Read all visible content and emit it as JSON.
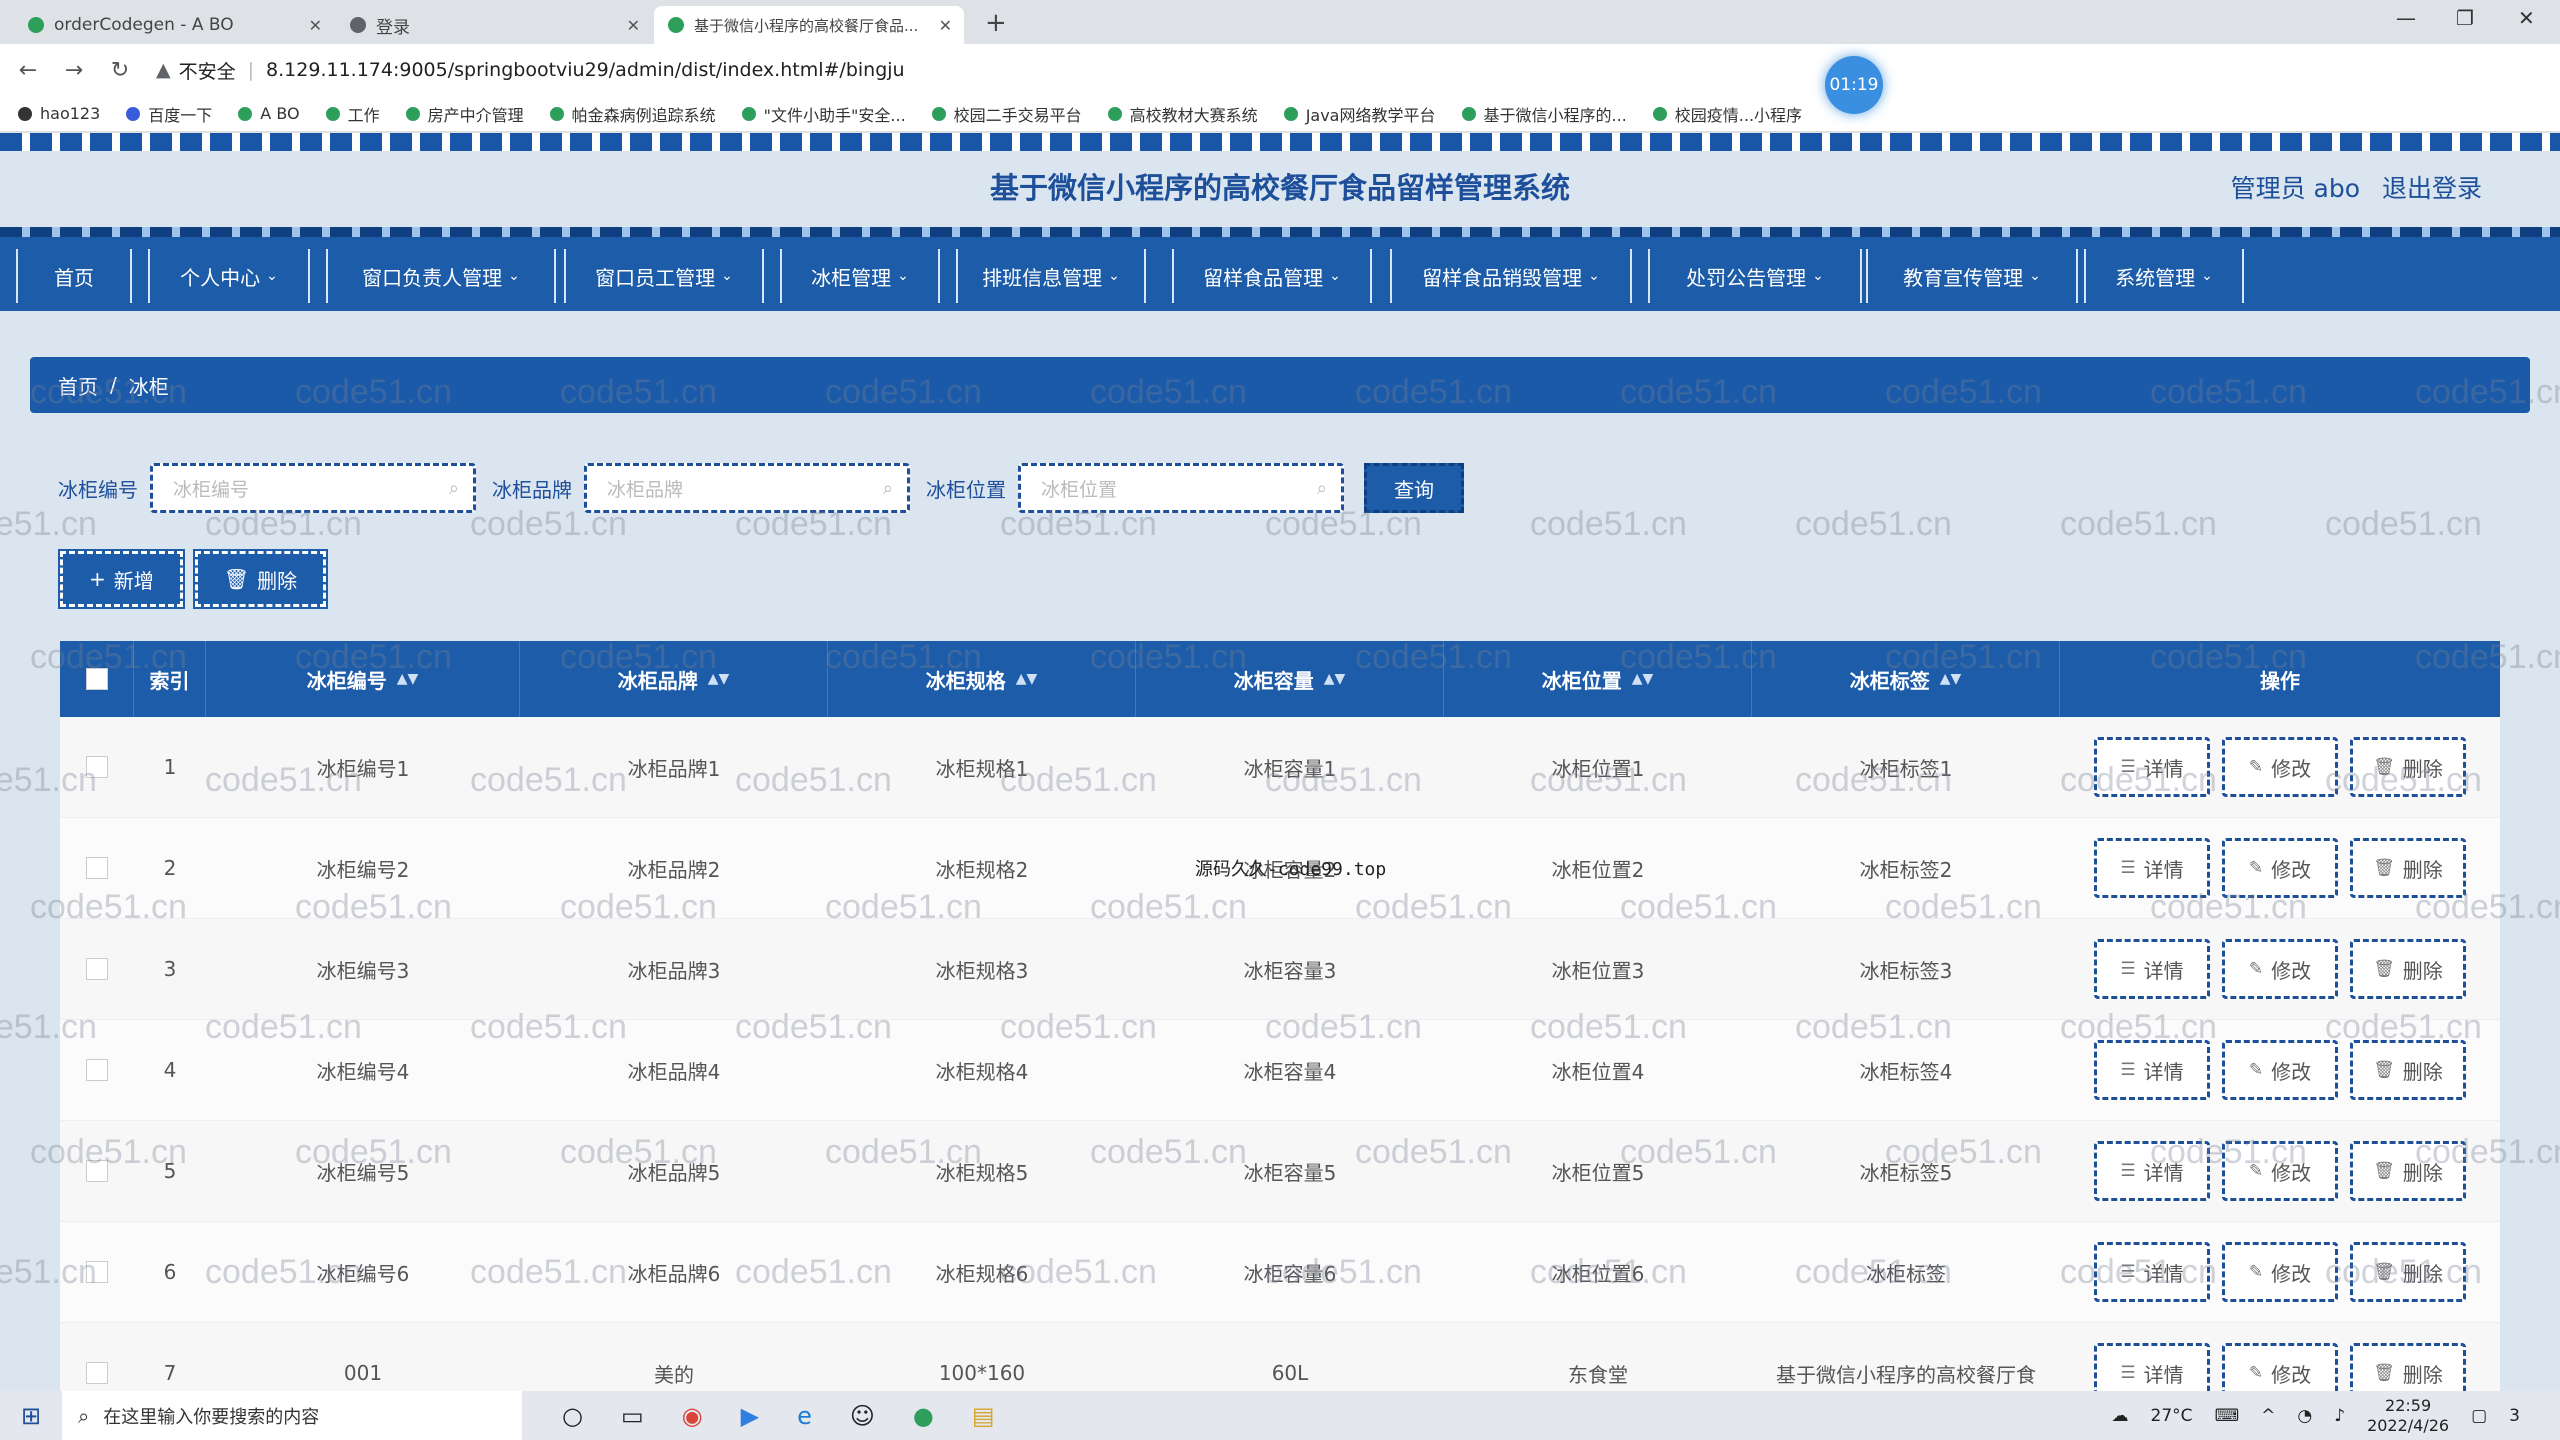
{
  "browser": {
    "tabs": [
      {
        "title": "orderCodegen - A BO",
        "active": false
      },
      {
        "title": "登录",
        "active": false
      },
      {
        "title": "基于微信小程序的高校餐厅食品...",
        "active": true
      }
    ],
    "new_tab": "+",
    "security": "不安全",
    "url": "8.129.11.174:9005/springbootviu29/admin/dist/index.html#/bingju",
    "timer": "01:19",
    "bookmarks": [
      "hao123",
      "百度一下",
      "A BO",
      "工作",
      "房产中介管理",
      "帕金森病例追踪系统",
      "\"文件小助手\"安全...",
      "校园二手交易平台",
      "高校教材大赛系统",
      "Java网络教学平台",
      "基于微信小程序的...",
      "校园疫情...小程序"
    ]
  },
  "header": {
    "title": "基于微信小程序的高校餐厅食品留样管理系统",
    "user": "管理员 abo",
    "logout": "退出登录"
  },
  "menu": [
    {
      "label": "首页",
      "caret": false
    },
    {
      "label": "个人中心",
      "caret": true
    },
    {
      "label": "窗口负责人管理",
      "caret": true
    },
    {
      "label": "窗口员工管理",
      "caret": true
    },
    {
      "label": "冰柜管理",
      "caret": true
    },
    {
      "label": "排班信息管理",
      "caret": true
    },
    {
      "label": "留样食品管理",
      "caret": true
    },
    {
      "label": "留样食品销毁管理",
      "caret": true
    },
    {
      "label": "处罚公告管理",
      "caret": true
    },
    {
      "label": "教育宣传管理",
      "caret": true
    },
    {
      "label": "系统管理",
      "caret": true
    }
  ],
  "breadcrumb": {
    "home": "首页",
    "sep": "/",
    "current": "冰柜"
  },
  "search": {
    "fields": [
      {
        "label": "冰柜编号",
        "placeholder": "冰柜编号"
      },
      {
        "label": "冰柜品牌",
        "placeholder": "冰柜品牌"
      },
      {
        "label": "冰柜位置",
        "placeholder": "冰柜位置"
      }
    ],
    "query_label": "查询"
  },
  "actions": {
    "add": "新增",
    "delete": "删除"
  },
  "table": {
    "columns": [
      "索引",
      "冰柜编号",
      "冰柜品牌",
      "冰柜规格",
      "冰柜容量",
      "冰柜位置",
      "冰柜标签",
      "操作"
    ],
    "rows": [
      [
        "1",
        "冰柜编号1",
        "冰柜品牌1",
        "冰柜规格1",
        "冰柜容量1",
        "冰柜位置1",
        "冰柜标签1"
      ],
      [
        "2",
        "冰柜编号2",
        "冰柜品牌2",
        "冰柜规格2",
        "冰柜容量2",
        "冰柜位置2",
        "冰柜标签2"
      ],
      [
        "3",
        "冰柜编号3",
        "冰柜品牌3",
        "冰柜规格3",
        "冰柜容量3",
        "冰柜位置3",
        "冰柜标签3"
      ],
      [
        "4",
        "冰柜编号4",
        "冰柜品牌4",
        "冰柜规格4",
        "冰柜容量4",
        "冰柜位置4",
        "冰柜标签4"
      ],
      [
        "5",
        "冰柜编号5",
        "冰柜品牌5",
        "冰柜规格5",
        "冰柜容量5",
        "冰柜位置5",
        "冰柜标签5"
      ],
      [
        "6",
        "冰柜编号6",
        "冰柜品牌6",
        "冰柜规格6",
        "冰柜容量6",
        "冰柜位置6",
        "冰柜标签"
      ],
      [
        "7",
        "001",
        "美的",
        "100*160",
        "60L",
        "东食堂",
        "基于微信小程序的高校餐厅食"
      ]
    ],
    "op_labels": {
      "detail": "详情",
      "edit": "修改",
      "delete": "删除"
    }
  },
  "overlay_text": "源码久久-code99.top",
  "watermark_text": "code51.cn",
  "taskbar": {
    "search_placeholder": "在这里输入你要搜索的内容",
    "weather": "27°C",
    "time": "22:59",
    "date": "2022/4/26",
    "notifications": "3"
  },
  "colors": {
    "primary": "#1d5ca8",
    "header_text": "#1d4f9a",
    "page_bg": "#dbe5ef"
  }
}
